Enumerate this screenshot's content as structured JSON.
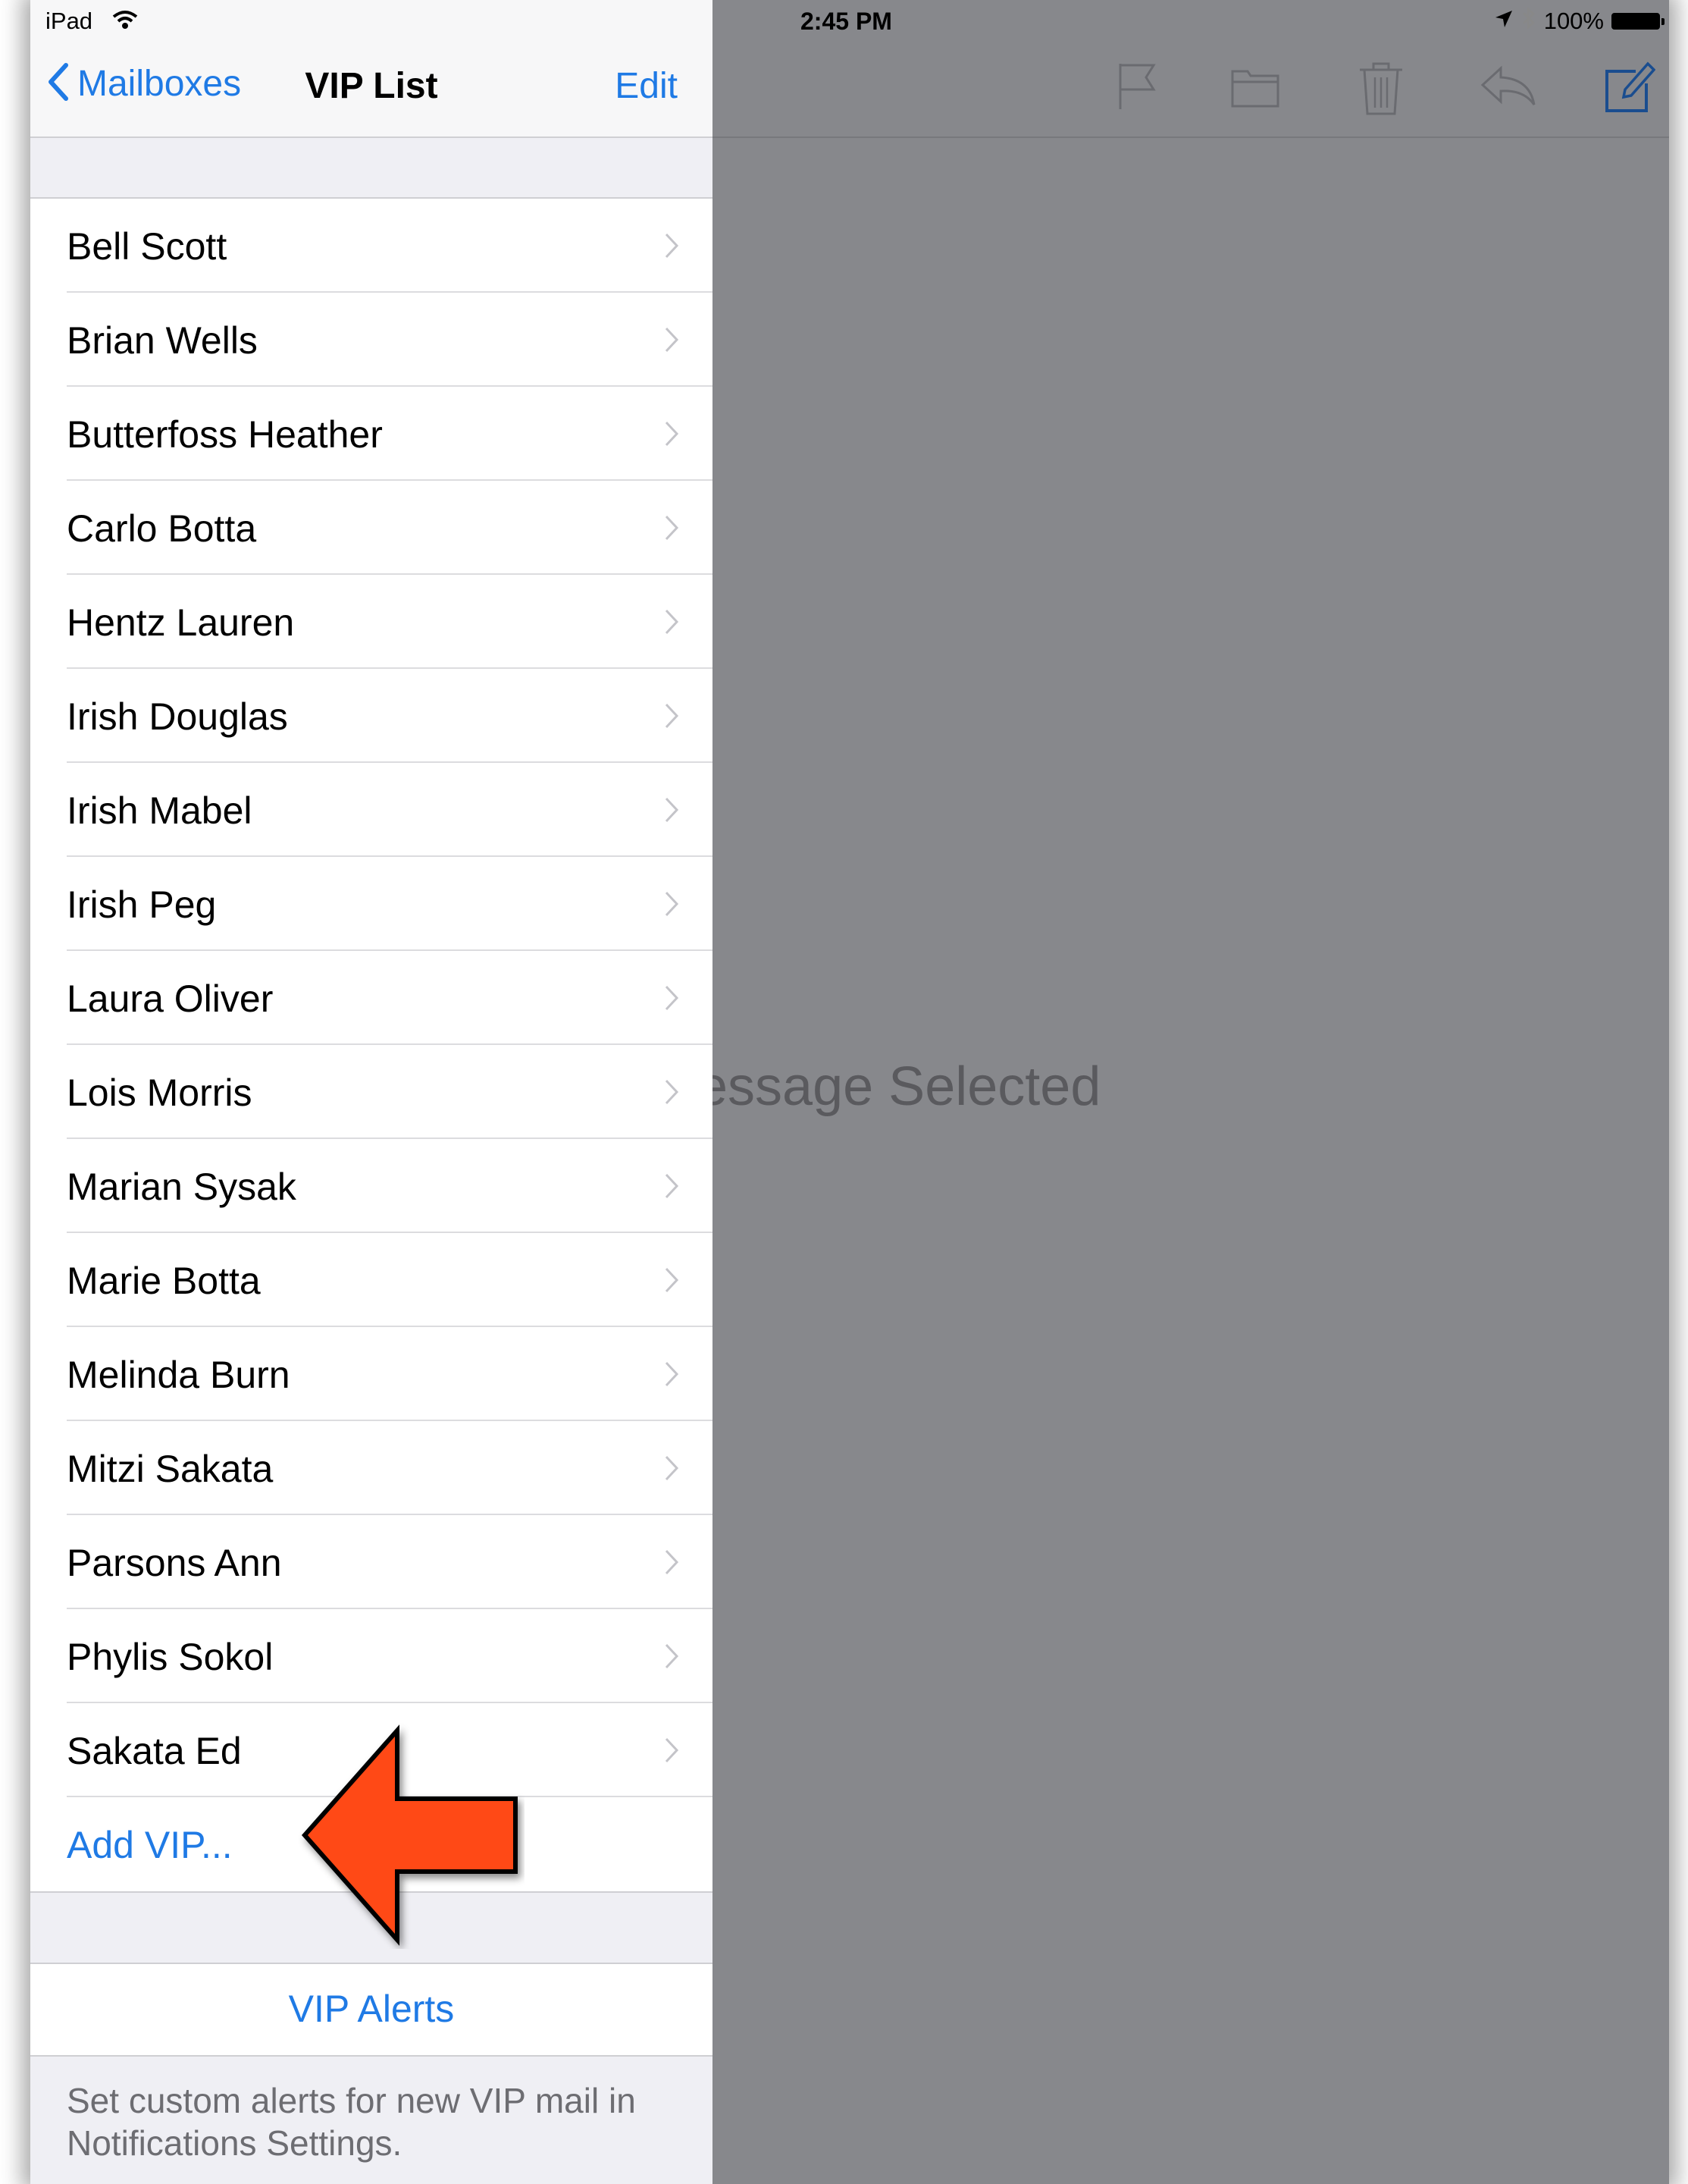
{
  "status_bar": {
    "device": "iPad",
    "time": "2:45 PM",
    "battery": "100%"
  },
  "nav": {
    "back_label": "Mailboxes",
    "title": "VIP List",
    "edit_label": "Edit"
  },
  "vip_list": [
    {
      "name": "Bell Scott"
    },
    {
      "name": "Brian Wells"
    },
    {
      "name": "Butterfoss Heather"
    },
    {
      "name": "Carlo Botta"
    },
    {
      "name": "Hentz Lauren"
    },
    {
      "name": "Irish Douglas"
    },
    {
      "name": "Irish Mabel"
    },
    {
      "name": "Irish Peg"
    },
    {
      "name": "Laura Oliver"
    },
    {
      "name": "Lois Morris"
    },
    {
      "name": "Marian Sysak"
    },
    {
      "name": "Marie Botta"
    },
    {
      "name": "Melinda Burn"
    },
    {
      "name": "Mitzi Sakata"
    },
    {
      "name": "Parsons Ann"
    },
    {
      "name": "Phylis Sokol"
    },
    {
      "name": "Sakata Ed"
    }
  ],
  "add_vip_label": "Add VIP...",
  "alerts": {
    "label": "VIP Alerts",
    "footer": "Set custom alerts for new VIP mail in Notifications Settings."
  },
  "detail": {
    "placeholder": "essage Selected",
    "toolbar": [
      "flag-icon",
      "folder-icon",
      "trash-icon",
      "reply-icon",
      "compose-icon"
    ]
  },
  "colors": {
    "accent": "#1f7ae5",
    "dim_overlay": "#87888c",
    "arrow": "#ff4a18"
  }
}
